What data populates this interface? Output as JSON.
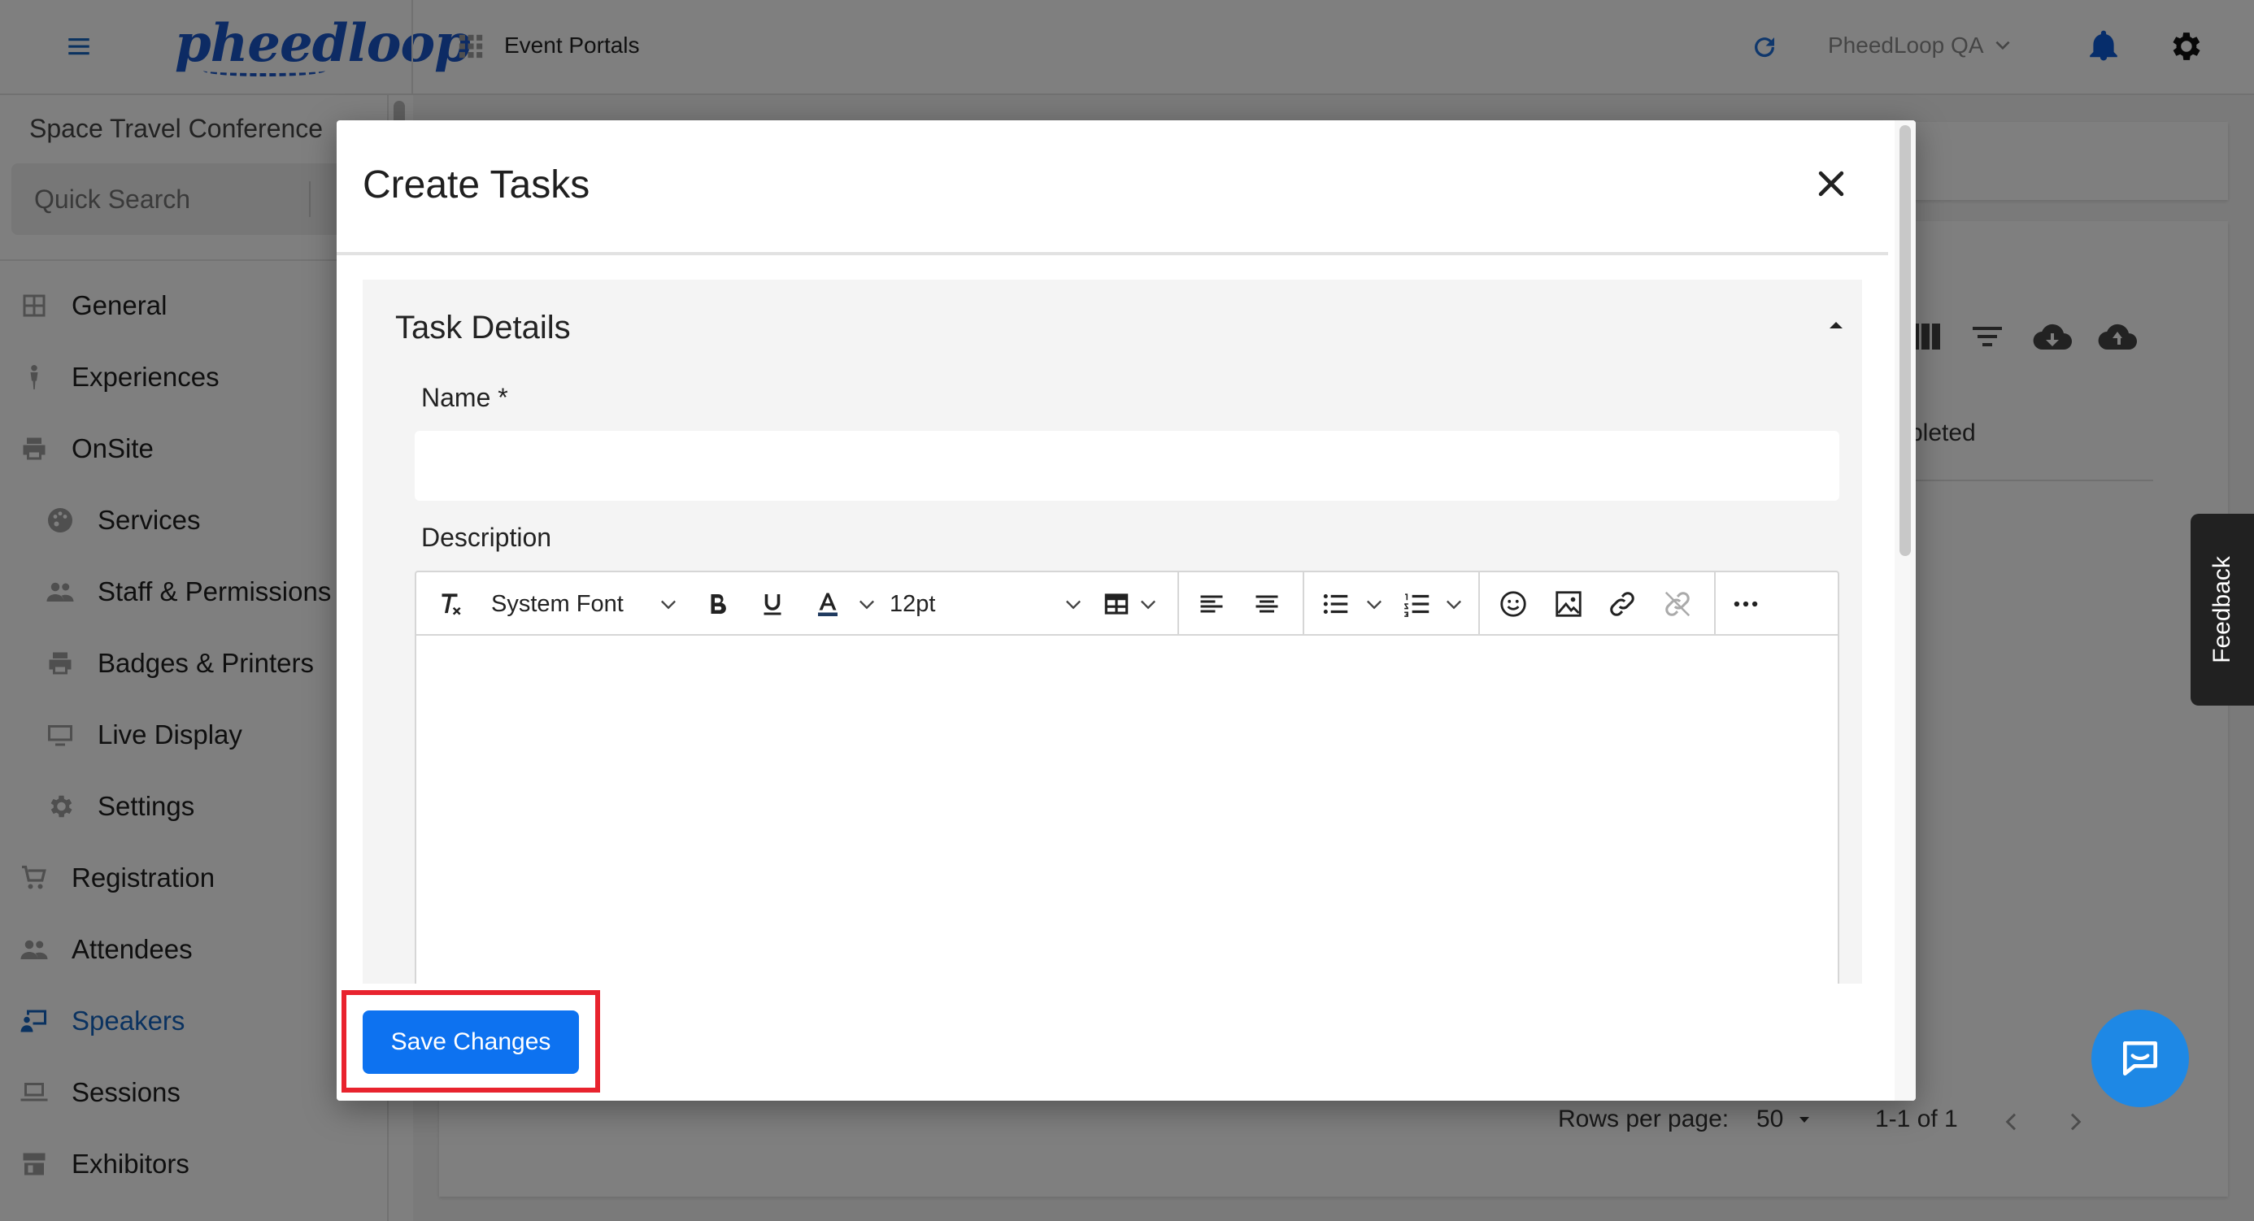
{
  "header": {
    "logo_text": "pheedloop",
    "portal_label": "Event Portals",
    "org_name": "PheedLoop QA"
  },
  "sidebar": {
    "event_name": "Space Travel Conference",
    "search_placeholder": "Quick Search",
    "items": [
      {
        "label": "General",
        "icon": "grid-icon"
      },
      {
        "label": "Experiences",
        "icon": "person-icon"
      },
      {
        "label": "OnSite",
        "icon": "printer-icon"
      },
      {
        "label": "Services",
        "icon": "palette-icon"
      },
      {
        "label": "Staff & Permissions",
        "icon": "people-icon"
      },
      {
        "label": "Badges & Printers",
        "icon": "printer-icon"
      },
      {
        "label": "Live Display",
        "icon": "monitor-icon"
      },
      {
        "label": "Settings",
        "icon": "gear-icon"
      },
      {
        "label": "Registration",
        "icon": "cart-icon"
      },
      {
        "label": "Attendees",
        "icon": "people-icon"
      },
      {
        "label": "Speakers",
        "icon": "presenter-icon"
      },
      {
        "label": "Sessions",
        "icon": "laptop-icon"
      },
      {
        "label": "Exhibitors",
        "icon": "store-icon"
      }
    ],
    "active_item": "Speakers"
  },
  "background": {
    "completed_text": "pleted",
    "rows_per_page_label": "Rows per page:",
    "rows_per_page_value": "50",
    "page_range": "1-1 of 1"
  },
  "feedback_label": "Feedback",
  "modal": {
    "title": "Create Tasks",
    "section_title": "Task Details",
    "name_label": "Name *",
    "name_value": "",
    "description_label": "Description",
    "toolbar": {
      "font_family": "System Font",
      "font_size": "12pt"
    },
    "save_label": "Save Changes"
  },
  "colors": {
    "accent": "#0d72f0",
    "highlight": "#e8232e",
    "active_nav": "#1565c0",
    "fab": "#1e88e5"
  }
}
